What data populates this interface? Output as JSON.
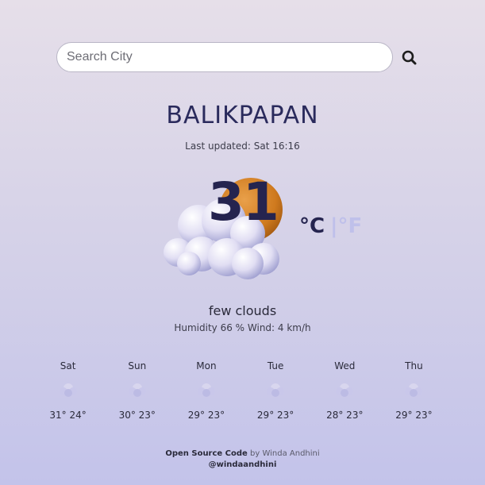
{
  "search": {
    "placeholder": "Search City",
    "value": ""
  },
  "weather": {
    "city": "BALIKPAPAN",
    "last_updated": "Last updated: Sat 16:16",
    "temperature": "31",
    "unit_celsius": "°C",
    "unit_fahrenheit": "|°F",
    "description": "few clouds",
    "details": "Humidity 66 % Wind: 4 km/h",
    "icon": "few-clouds-day-icon"
  },
  "forecast": [
    {
      "day": "Sat",
      "temps": "31° 24°",
      "icon": "cloud-icon"
    },
    {
      "day": "Sun",
      "temps": "30° 23°",
      "icon": "cloud-icon"
    },
    {
      "day": "Mon",
      "temps": "29° 23°",
      "icon": "cloud-icon"
    },
    {
      "day": "Tue",
      "temps": "29° 23°",
      "icon": "cloud-icon"
    },
    {
      "day": "Wed",
      "temps": "28° 23°",
      "icon": "cloud-icon"
    },
    {
      "day": "Thu",
      "temps": "29° 23°",
      "icon": "cloud-icon"
    }
  ],
  "footer": {
    "source_link": "Open Source Code",
    "by_text": " by Winda Andhini",
    "handle": "@windaandhini"
  },
  "colors": {
    "accent": "#25244f",
    "inactive_unit": "#bfc0ea",
    "sun": "#d98020"
  }
}
